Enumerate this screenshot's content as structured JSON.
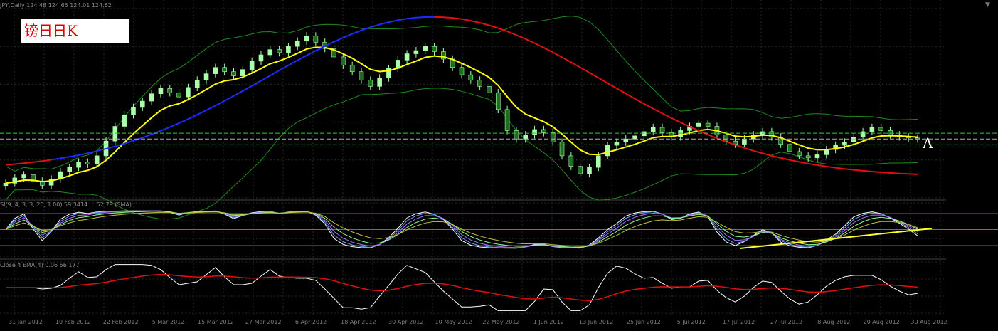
{
  "header": {
    "price_info": "JPY,Daily  124.48 124.65 124.01 124.62",
    "title_label": "镑日日K",
    "marker_label": "A",
    "oscillator_info": "SI(9, 4, 3, 3, 20, 1.00) 59.3414 ... 52.79 (SMA)",
    "ema_info": "Close 4 EMA(4) 0.06 56 177"
  },
  "chart_data": [
    {
      "type": "candlestick",
      "title": "",
      "x_ticks": [
        "31 Jan 2012",
        "10 Feb 2012",
        "22 Feb 2012",
        "5 Mar 2012",
        "15 Mar 2012",
        "27 Mar 2012",
        "6 Apr 2012",
        "18 Apr 2012",
        "30 Apr 2012",
        "10 May 2012",
        "22 May 2012",
        "1 Jun 2012",
        "13 Jun 2012",
        "25 Jun 2012",
        "5 Jul 2012",
        "17 Jul 2012",
        "27 Jul 2012",
        "8 Aug 2012",
        "20 Aug 2012",
        "30 Aug 2012"
      ],
      "price_label": "124.95 line",
      "close_series": [
        120.4,
        120.9,
        121.2,
        120.6,
        120.2,
        120.8,
        121.5,
        121.9,
        122.4,
        122.2,
        123.0,
        124.4,
        125.8,
        126.9,
        127.6,
        128.2,
        128.9,
        129.4,
        129.0,
        128.6,
        129.5,
        130.2,
        130.8,
        131.4,
        131.0,
        130.6,
        131.2,
        132.0,
        132.6,
        133.1,
        132.8,
        133.4,
        133.9,
        134.4,
        133.8,
        133.2,
        132.4,
        131.6,
        131.0,
        130.2,
        129.6,
        130.4,
        131.3,
        132.1,
        132.7,
        133.0,
        133.4,
        132.9,
        132.2,
        131.4,
        130.7,
        130.2,
        129.6,
        129.0,
        127.4,
        125.4,
        124.6,
        125.0,
        125.5,
        125.2,
        124.3,
        123.0,
        122.0,
        121.3,
        121.9,
        123.0,
        124.0,
        124.3,
        124.6,
        124.9,
        125.3,
        125.7,
        125.2,
        124.8,
        125.4,
        125.8,
        126.1,
        125.8,
        125.0,
        124.4,
        124.1,
        124.6,
        125.0,
        125.3,
        124.8,
        124.1,
        123.4,
        123.0,
        122.8,
        123.1,
        123.6,
        124.0,
        124.3,
        124.8,
        125.3,
        125.7,
        125.4,
        125.0,
        124.8,
        124.7,
        124.6
      ],
      "bollinger": {
        "period": 20,
        "color": "#1f8a1f"
      },
      "moving_averages": [
        {
          "name": "",
          "color": "#ffff00",
          "role": "fast"
        },
        {
          "name": "",
          "color": "#1e2bff",
          "role": "slow rising"
        },
        {
          "name": "",
          "color": "#e01010",
          "role": "slow falling"
        }
      ],
      "ylim": [
        119,
        137
      ]
    },
    {
      "type": "line",
      "title": "",
      "series_colors": [
        "#ffffff",
        "#6aa0ff",
        "#b070ff",
        "#88ff88",
        "#c0c040"
      ],
      "levels": [
        80,
        50,
        20
      ],
      "ylim": [
        0,
        100
      ],
      "support_trendline": {
        "color": "#ffff30"
      }
    },
    {
      "type": "line",
      "title": "",
      "series_colors": [
        "#ffffff",
        "#e01010"
      ],
      "ylim": [
        0,
        100
      ]
    }
  ],
  "colors": {
    "background": "#000000",
    "grid": "#2c2c2c",
    "bull_candle": "#aaffaa",
    "bear_candle": "#1f6e1f",
    "tick_text": "#7c7c7c"
  }
}
